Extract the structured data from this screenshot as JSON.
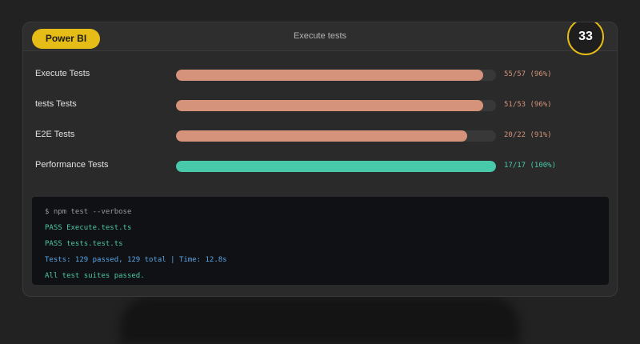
{
  "header": {
    "badge": "Power BI",
    "title": "Execute tests",
    "score": "33"
  },
  "colors": {
    "accent": "#e6bc17",
    "partial": "#d4937a",
    "complete": "#48c9a9"
  },
  "suites": [
    {
      "label": "Execute Tests",
      "passed": 55,
      "total": 57,
      "progress": 0.96,
      "stat": "55/57 (96%)",
      "status": "partial"
    },
    {
      "label": "tests Tests",
      "passed": 51,
      "total": 53,
      "progress": 0.96,
      "stat": "51/53 (96%)",
      "status": "partial"
    },
    {
      "label": "E2E Tests",
      "passed": 20,
      "total": 22,
      "progress": 0.91,
      "stat": "20/22 (91%)",
      "status": "partial"
    },
    {
      "label": "Performance Tests",
      "passed": 17,
      "total": 17,
      "progress": 1.0,
      "stat": "17/17 (100%)",
      "status": "complete"
    }
  ],
  "terminal": {
    "lines": [
      {
        "text": "$ npm test --verbose",
        "color": "#9a9a9a"
      },
      {
        "text": "PASS Execute.test.ts",
        "color": "#4ec9a4"
      },
      {
        "text": "PASS tests.test.ts",
        "color": "#4ec9a4"
      },
      {
        "text": "Tests: 129 passed, 129 total | Time: 12.8s",
        "color": "#5aa6e6"
      },
      {
        "text": "All test suites passed.",
        "color": "#4ec9a4"
      }
    ]
  }
}
